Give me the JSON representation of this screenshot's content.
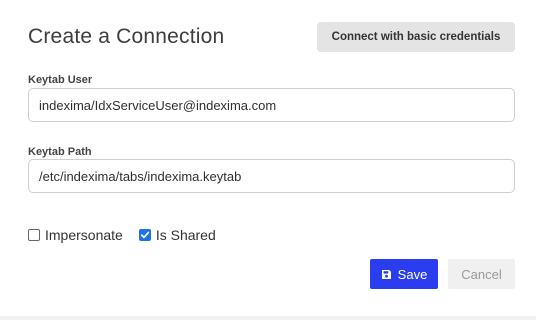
{
  "dialog": {
    "title": "Create a Connection",
    "basic_credentials_label": "Connect with basic credentials"
  },
  "fields": {
    "keytab_user": {
      "label": "Keytab User",
      "value": "indexima/IdxServiceUser@indexima.com"
    },
    "keytab_path": {
      "label": "Keytab Path",
      "value": "/etc/indexima/tabs/indexima.keytab"
    }
  },
  "options": {
    "impersonate": {
      "label": "Impersonate",
      "checked": false
    },
    "is_shared": {
      "label": "Is Shared",
      "checked": true
    }
  },
  "actions": {
    "save_label": "Save",
    "save_icon": "floppy-disk-icon",
    "cancel_label": "Cancel"
  },
  "colors": {
    "primary": "#2a3ef0",
    "checkbox_checked": "#1a73e8",
    "secondary_button_bg": "#e4e4e4",
    "cancel_bg": "#f0f0f0",
    "cancel_text": "#999999"
  }
}
